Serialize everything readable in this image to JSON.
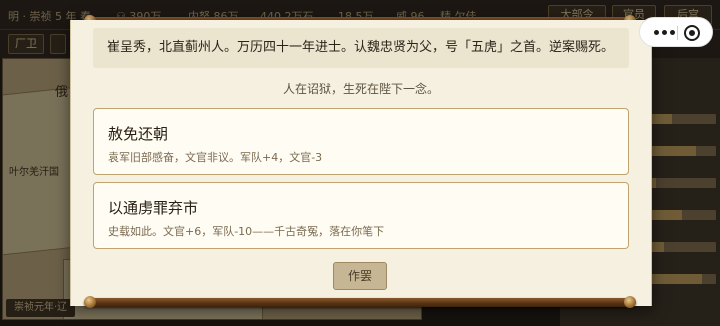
{
  "topbar": {
    "stats": [
      "明 · 崇祯 5 年 春",
      "⚇ 390万",
      "内帑 86万",
      "440.2万石",
      "18.5万",
      "威 96",
      "精 欠佳"
    ],
    "buttons": [
      "大部令",
      "官员",
      "后宫"
    ]
  },
  "subbar": {
    "chip": "厂卫"
  },
  "map": {
    "label_top": "俄",
    "label_left": "叶尔羌汗国"
  },
  "map_footer": "崇祯元年·辽",
  "right_panel": {
    "head": "时"
  },
  "dialog": {
    "profile": "崔呈秀，北直蓟州人。万历四十一年进士。认魏忠贤为父，号「五虎」之首。逆案赐死。",
    "prompt": "人在诏狱，生死在陛下一念。",
    "options": [
      {
        "title": "赦免还朝",
        "desc": "袁军旧部感奋，文官非议。军队+4，文官-3"
      },
      {
        "title": "以通虏罪弃市",
        "desc": "史载如此。文官+6，军队-10——千古奇冤，落在你笔下"
      }
    ],
    "dismiss_label": "作罢"
  },
  "capsule": {
    "more_icon": "more-dots-icon",
    "close_icon": "close-miniprogram-icon"
  }
}
